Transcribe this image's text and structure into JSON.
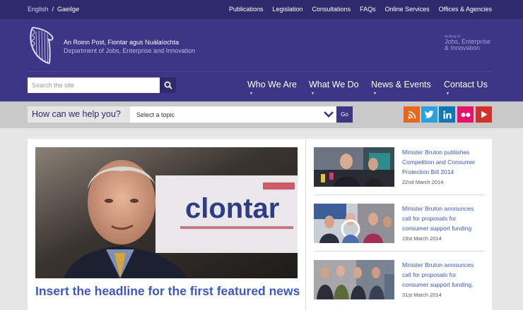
{
  "utility": {
    "lang_en": "English",
    "lang_sep": "/",
    "lang_ga": "Gaeilge",
    "links": [
      "Publications",
      "Legislation",
      "Consultations",
      "FAQs",
      "Online Services",
      "Offices & Agencies"
    ]
  },
  "header": {
    "dept_irish": "An Roinn Post, Fiontar agus Nuálaíochta",
    "dept_english": "Department of Jobs, Enterprise and Innovation",
    "working_small": "Working for",
    "working_line1": "Jobs, Enterprise",
    "working_line2": "& Innovation"
  },
  "search": {
    "placeholder": "Search the site"
  },
  "nav": {
    "items": [
      "Who We Are",
      "What We Do",
      "News & Events",
      "Contact Us"
    ],
    "caret": "▼"
  },
  "helpbar": {
    "label": "How can we help you?",
    "topic_value": "Select a topic",
    "go_label": "Go"
  },
  "social": [
    {
      "icon": "rss-icon",
      "color": "#e8661f"
    },
    {
      "icon": "twitter-icon",
      "color": "#2aa3dd"
    },
    {
      "icon": "linkedin-icon",
      "color": "#0e77b5"
    },
    {
      "icon": "flickr-icon",
      "color": "#e8126e"
    },
    {
      "icon": "youtube-icon",
      "color": "#d0312a"
    }
  ],
  "featured": {
    "headline": "Insert the headline for the first featured news",
    "sign_text": "clontar"
  },
  "news": [
    {
      "title": "Minister Bruton publishes Competition and Consumer Protection Bill 2014",
      "date": "22nd March 2014"
    },
    {
      "title": "Minister Bruton announces call for proposals for consumer support funding",
      "date": "19st March 2014"
    },
    {
      "title": "Minister Bruton announces call for proposals for consumer support funding.",
      "date": "31st March 2014"
    }
  ],
  "colors": {
    "header_purple": "#3d3585",
    "utility_purple": "#2f2a6e",
    "link_blue": "#3d57c4"
  }
}
